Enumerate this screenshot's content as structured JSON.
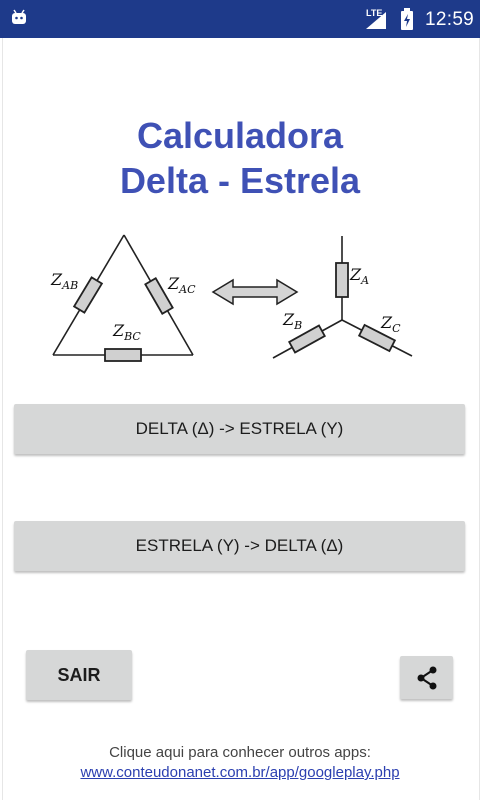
{
  "status_bar": {
    "network": "LTE",
    "time": "12:59",
    "icons": [
      "android-icon",
      "signal-icon",
      "battery-icon"
    ],
    "background": "#1e3a8a"
  },
  "header": {
    "title_line1": "Calculadora",
    "title_line2": "Delta - Estrela",
    "title_color": "#3f51b5"
  },
  "diagram": {
    "delta_labels": [
      "Z",
      "AB",
      "Z",
      "AC",
      "Z",
      "BC"
    ],
    "star_labels": [
      "Z",
      "A",
      "Z",
      "B",
      "Z",
      "C"
    ],
    "arrow_icon": "double-arrow-icon"
  },
  "buttons": {
    "delta_to_estrela": "DELTA (Δ) -> ESTRELA (Y)",
    "estrela_to_delta": "ESTRELA (Y) -> DELTA (Δ)",
    "sair": "SAIR",
    "share_icon": "share-icon"
  },
  "footer": {
    "text": "Clique aqui para conhecer outros apps:",
    "link": "www.conteudonanet.com.br/app/googleplay.php"
  }
}
